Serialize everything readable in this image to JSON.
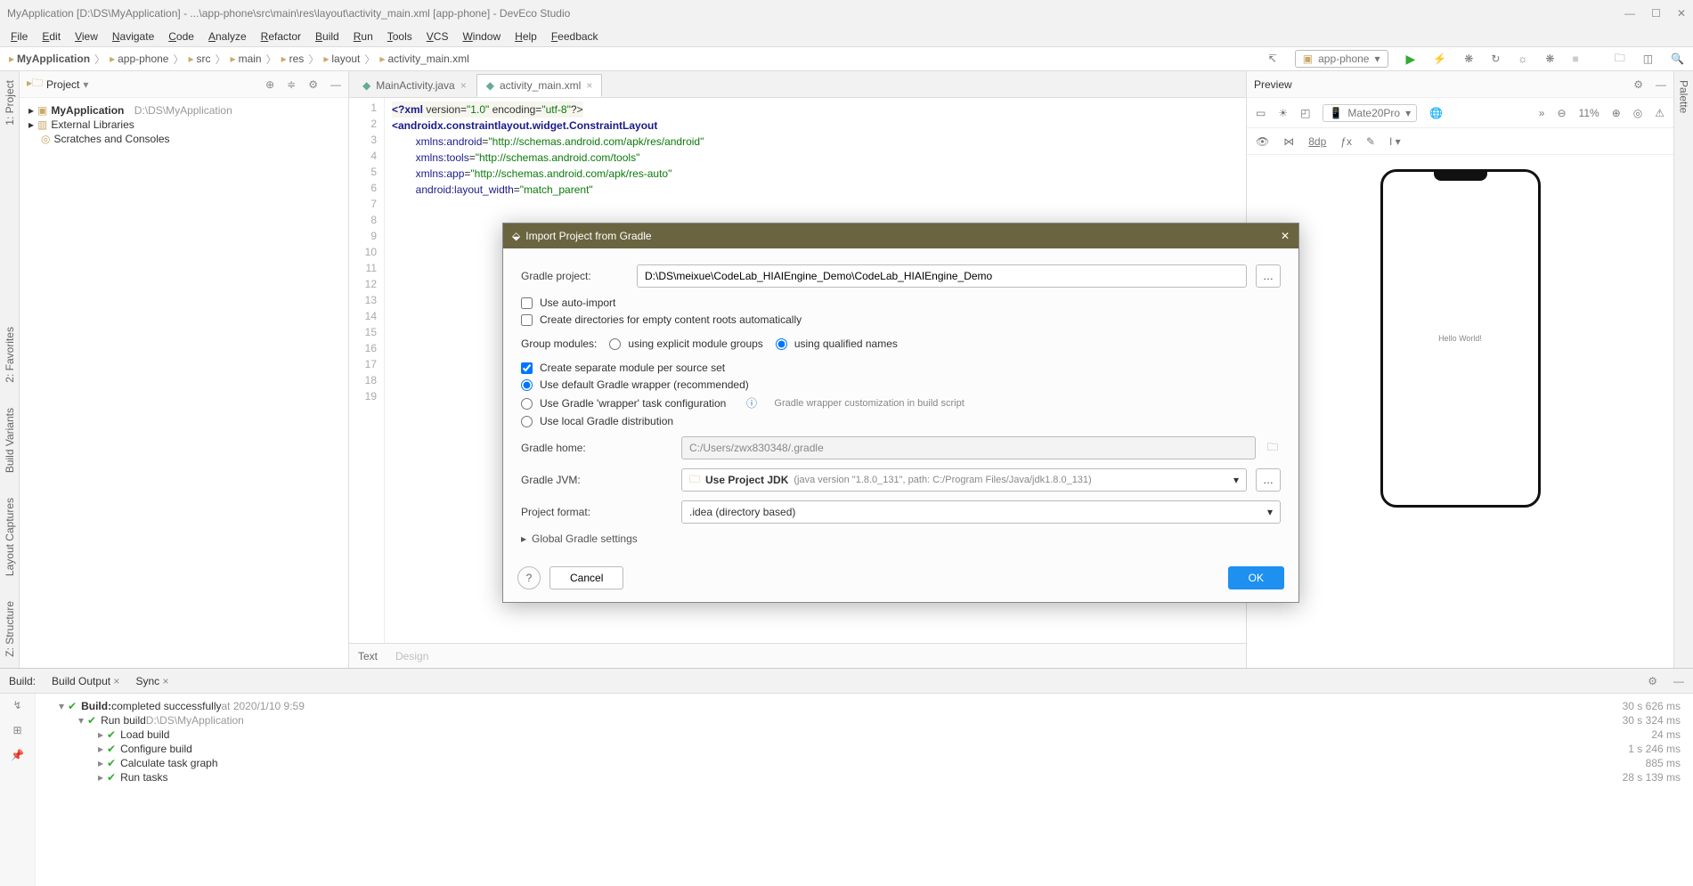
{
  "title": "MyApplication [D:\\DS\\MyApplication] - ...\\app-phone\\src\\main\\res\\layout\\activity_main.xml [app-phone] - DevEco Studio",
  "menu": [
    "File",
    "Edit",
    "View",
    "Navigate",
    "Code",
    "Analyze",
    "Refactor",
    "Build",
    "Run",
    "Tools",
    "VCS",
    "Window",
    "Help",
    "Feedback"
  ],
  "crumbs": [
    "MyApplication",
    "app-phone",
    "src",
    "main",
    "res",
    "layout",
    "activity_main.xml"
  ],
  "runconfig": "app-phone",
  "zoom": "11%",
  "projpanel": {
    "title": "Project"
  },
  "tree": {
    "app": "MyApplication",
    "apppath": "D:\\DS\\MyApplication",
    "ext": "External Libraries",
    "scr": "Scratches and Consoles"
  },
  "tabs": [
    {
      "label": "MainActivity.java",
      "active": false
    },
    {
      "label": "activity_main.xml",
      "active": true
    }
  ],
  "code": [
    "<?xml version=\"1.0\" encoding=\"utf-8\"?>",
    "<androidx.constraintlayout.widget.ConstraintLayout",
    "        xmlns:android=\"http://schemas.android.com/apk/res/android\"",
    "        xmlns:tools=\"http://schemas.android.com/tools\"",
    "        xmlns:app=\"http://schemas.android.com/apk/res-auto\"",
    "        android:layout_width=\"match_parent\""
  ],
  "linecount": 19,
  "bottabs": {
    "text": "Text",
    "design": "Design"
  },
  "preview": {
    "title": "Preview",
    "device": "Mate20Pro",
    "dp": "8dp",
    "hello": "Hello World!"
  },
  "build": {
    "title": "Build:",
    "tabs": [
      "Build Output",
      "Sync"
    ],
    "rows": [
      {
        "lvl": 0,
        "txt": "Build:",
        "suffix": "completed successfully",
        "dim": "at 2020/1/10 9:59",
        "time": "30 s 626 ms"
      },
      {
        "lvl": 1,
        "txt": "Run build",
        "dim": "D:\\DS\\MyApplication",
        "time": "30 s 324 ms"
      },
      {
        "lvl": 2,
        "txt": "Load build",
        "time": "24 ms"
      },
      {
        "lvl": 2,
        "txt": "Configure build",
        "time": "1 s 246 ms"
      },
      {
        "lvl": 2,
        "txt": "Calculate task graph",
        "time": "885 ms"
      },
      {
        "lvl": 2,
        "txt": "Run tasks",
        "time": "28 s 139 ms"
      }
    ]
  },
  "modal": {
    "title": "Import Project from Gradle",
    "projectlabel": "Gradle project:",
    "projectpath": "D:\\DS\\meixue\\CodeLab_HIAIEngine_Demo\\CodeLab_HIAIEngine_Demo",
    "autoimport": "Use auto-import",
    "createdirs": "Create directories for empty content roots automatically",
    "groupmodules": "Group modules:",
    "explicit": "using explicit module groups",
    "qualified": "using qualified names",
    "separate": "Create separate module per source set",
    "defaultwrap": "Use default Gradle wrapper (recommended)",
    "taskwrap": "Use Gradle 'wrapper' task configuration",
    "taskwraphint": "Gradle wrapper customization in build script",
    "localdist": "Use local Gradle distribution",
    "gradlehome_l": "Gradle home:",
    "gradlehome": "C:/Users/zwx830348/.gradle",
    "gradlejvm_l": "Gradle JVM:",
    "gradlejvm": "Use Project JDK",
    "gradlejvm_detail": "(java version \"1.8.0_131\", path: C:/Program Files/Java/jdk1.8.0_131)",
    "projformat_l": "Project format:",
    "projformat": ".idea (directory based)",
    "globals": "Global Gradle settings",
    "ok": "OK",
    "cancel": "Cancel"
  },
  "leftTabs": [
    "1: Project",
    "2: Favorites",
    "Build Variants",
    "Layout Captures",
    "Z: Structure"
  ],
  "rightTabs": [
    "Palette"
  ]
}
